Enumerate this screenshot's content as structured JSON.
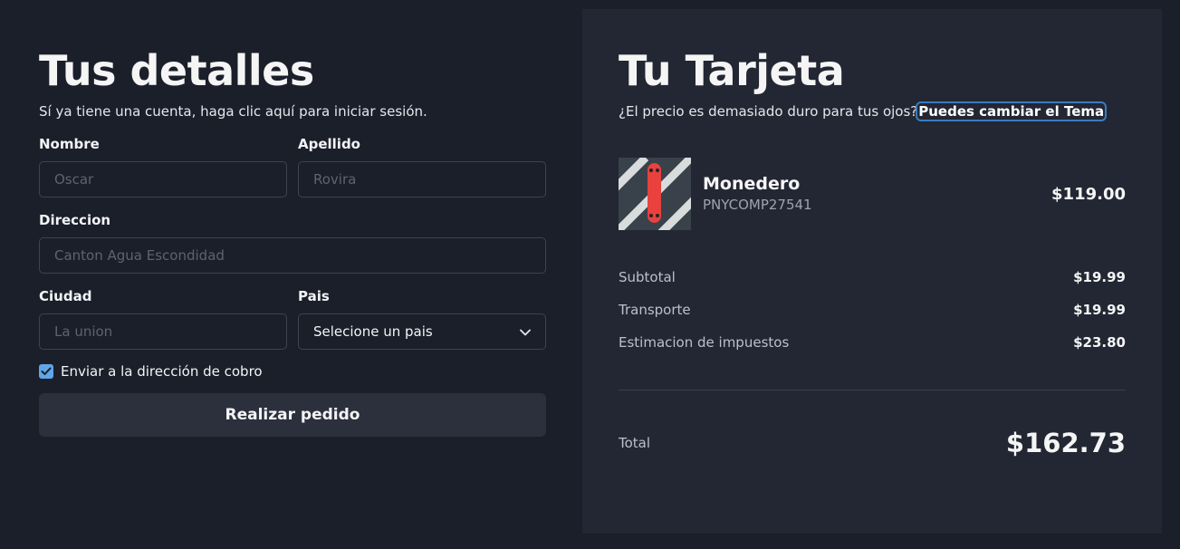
{
  "details": {
    "title": "Tus detalles",
    "subtitle": "Sí ya tiene una cuenta, haga clic aquí para iniciar sesión.",
    "first_name": {
      "label": "Nombre",
      "placeholder": "Oscar"
    },
    "last_name": {
      "label": "Apellido",
      "placeholder": "Rovira"
    },
    "address": {
      "label": "Direccion",
      "placeholder": "Canton Agua Escondidad"
    },
    "city": {
      "label": "Ciudad",
      "placeholder": "La union"
    },
    "country": {
      "label": "Pais",
      "selected": "Selecione un pais"
    },
    "ship_checkbox": {
      "label": "Enviar a la dirección de cobro",
      "checked": true
    },
    "submit_label": "Realizar pedido"
  },
  "cart": {
    "title": "Tu Tarjeta",
    "subtitle": "¿El precio es demasiado duro para tus ojos?",
    "theme_link": "Puedes cambiar el Tema",
    "product": {
      "name": "Monedero",
      "code": "PNYCOMP27541",
      "price": "$119.00"
    },
    "summary": [
      {
        "label": "Subtotal",
        "value": "$19.99"
      },
      {
        "label": "Transporte",
        "value": "$19.99"
      },
      {
        "label": "Estimacion de impuestos",
        "value": "$23.80"
      }
    ],
    "total_label": "Total",
    "total_value": "$162.73"
  },
  "colors": {
    "background": "#1b1f2a",
    "panel": "#222733",
    "accent": "#60a5e8",
    "focus_outline": "#3b7bbf"
  }
}
